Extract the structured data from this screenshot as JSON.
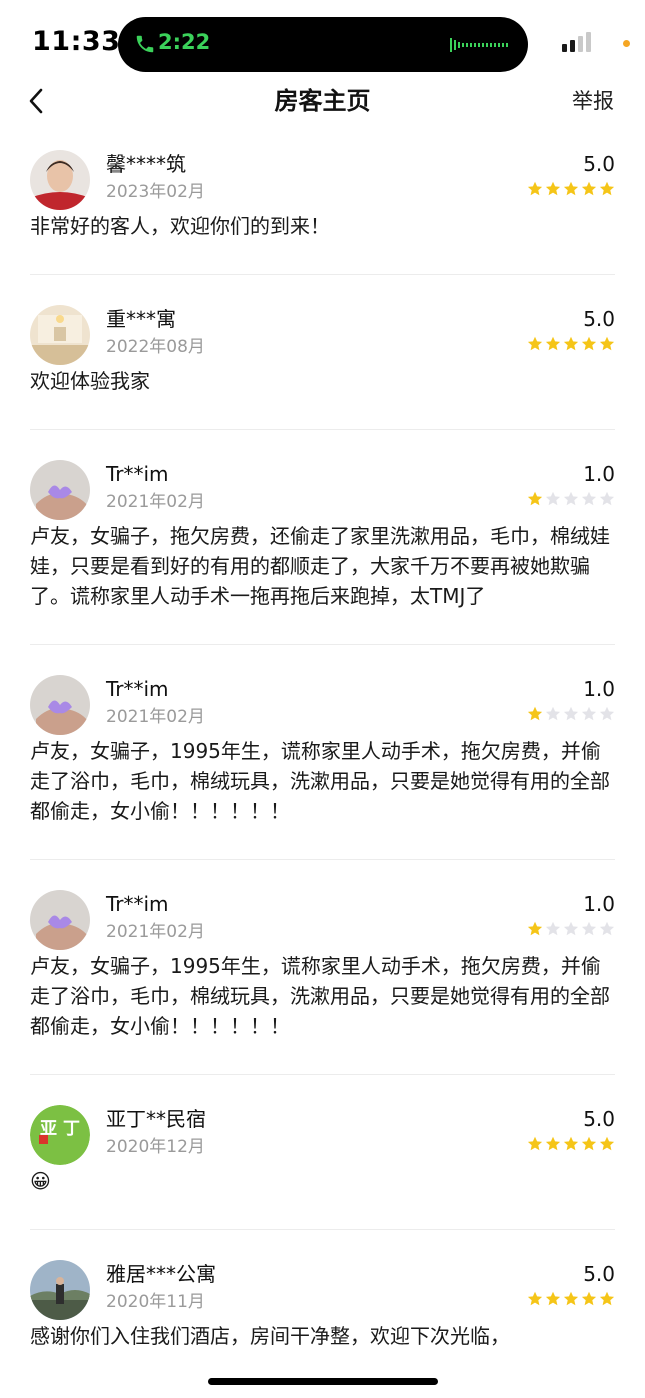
{
  "status_bar": {
    "time": "11:33",
    "call_duration": "2:22",
    "call_icon": "phone-icon",
    "accent_green": "#3bd15a",
    "indicator_color": "#f5a623"
  },
  "nav": {
    "back_icon": "chevron-left-icon",
    "title": "房客主页",
    "report_label": "举报"
  },
  "theme": {
    "star_filled": "#f5c518",
    "star_empty": "#e3e3e8"
  },
  "reviews": [
    {
      "name": "馨****筑",
      "date": "2023年02月",
      "score": "5.0",
      "rating": 5,
      "comment": "非常好的客人，欢迎你们的到来！",
      "avatar": "person-avatar"
    },
    {
      "name": "重***寓",
      "date": "2022年08月",
      "score": "5.0",
      "rating": 5,
      "comment": "欢迎体验我家",
      "avatar": "room-avatar"
    },
    {
      "name": "Tr**im",
      "date": "2021年02月",
      "score": "1.0",
      "rating": 1,
      "comment": "卢友，女骗子，拖欠房费，还偷走了家里洗漱用品，毛巾，棉绒娃娃，只要是看到好的有用的都顺走了，大家千万不要再被她欺骗了。谎称家里人动手术一拖再拖后来跑掉，太TMJ了",
      "avatar": "hand-avatar"
    },
    {
      "name": "Tr**im",
      "date": "2021年02月",
      "score": "1.0",
      "rating": 1,
      "comment": "卢友，女骗子，1995年生，谎称家里人动手术，拖欠房费，并偷走了浴巾，毛巾，棉绒玩具，洗漱用品，只要是她觉得有用的全部都偷走，女小偷！！！！！！",
      "avatar": "hand-avatar"
    },
    {
      "name": "Tr**im",
      "date": "2021年02月",
      "score": "1.0",
      "rating": 1,
      "comment": "卢友，女骗子，1995年生，谎称家里人动手术，拖欠房费，并偷走了浴巾，毛巾，棉绒玩具，洗漱用品，只要是她觉得有用的全部都偷走，女小偷！！！！！！",
      "avatar": "hand-avatar"
    },
    {
      "name": "亚丁**民宿",
      "date": "2020年12月",
      "score": "5.0",
      "rating": 5,
      "comment": "😀",
      "avatar": "yading-logo-avatar",
      "avatar_text": "亚 丁"
    },
    {
      "name": "雅居***公寓",
      "date": "2020年11月",
      "score": "5.0",
      "rating": 5,
      "comment": "感谢你们入住我们酒店，房间干净整，欢迎下次光临，",
      "avatar": "landscape-avatar"
    }
  ]
}
